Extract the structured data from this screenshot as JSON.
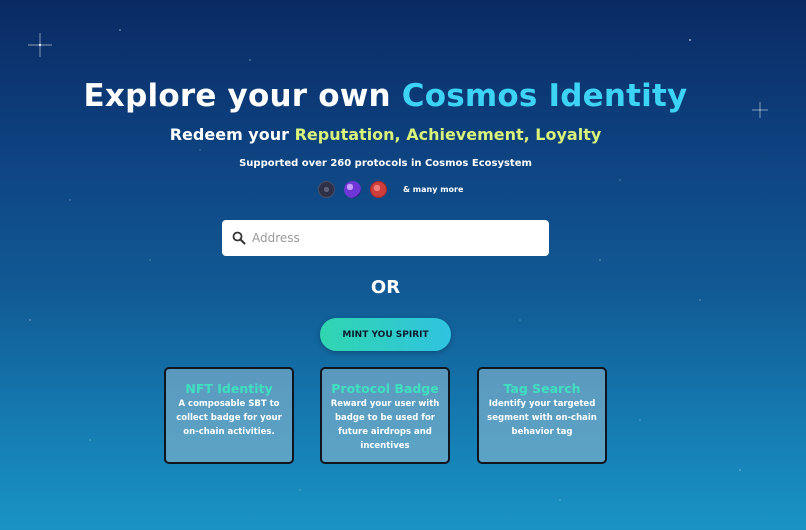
{
  "hero": {
    "title_prefix": "Explore your own ",
    "title_accent": "Cosmos Identity",
    "subtitle_prefix": "Redeem your ",
    "subtitle_accent": "Reputation, Achievement, Loyalty",
    "supported_text": "Supported over 260 protocols in Cosmos Ecosystem",
    "protocol_icons": [
      "cosmos-hub-icon",
      "osmosis-icon",
      "juno-icon"
    ],
    "more_text": "& many more"
  },
  "search": {
    "placeholder": "Address",
    "value": ""
  },
  "or_text": "OR",
  "mint_button": "MINT YOU SPIRIT",
  "cards": [
    {
      "title": "NFT Identity",
      "description": "A composable SBT to collect badge for your on-chain activities."
    },
    {
      "title": "Protocol Badge",
      "description": "Reward your user with badge to be used for future airdrops and incentives"
    },
    {
      "title": "Tag Search",
      "description": "Identify your targeted segment with on-chain behavior tag"
    }
  ],
  "colors": {
    "accent_cyan": "#3dd3f5",
    "accent_yellow": "#d8f27a",
    "card_title": "#3fe0c0",
    "button_gradient_start": "#31d6b0",
    "button_gradient_end": "#2fc3e0"
  }
}
